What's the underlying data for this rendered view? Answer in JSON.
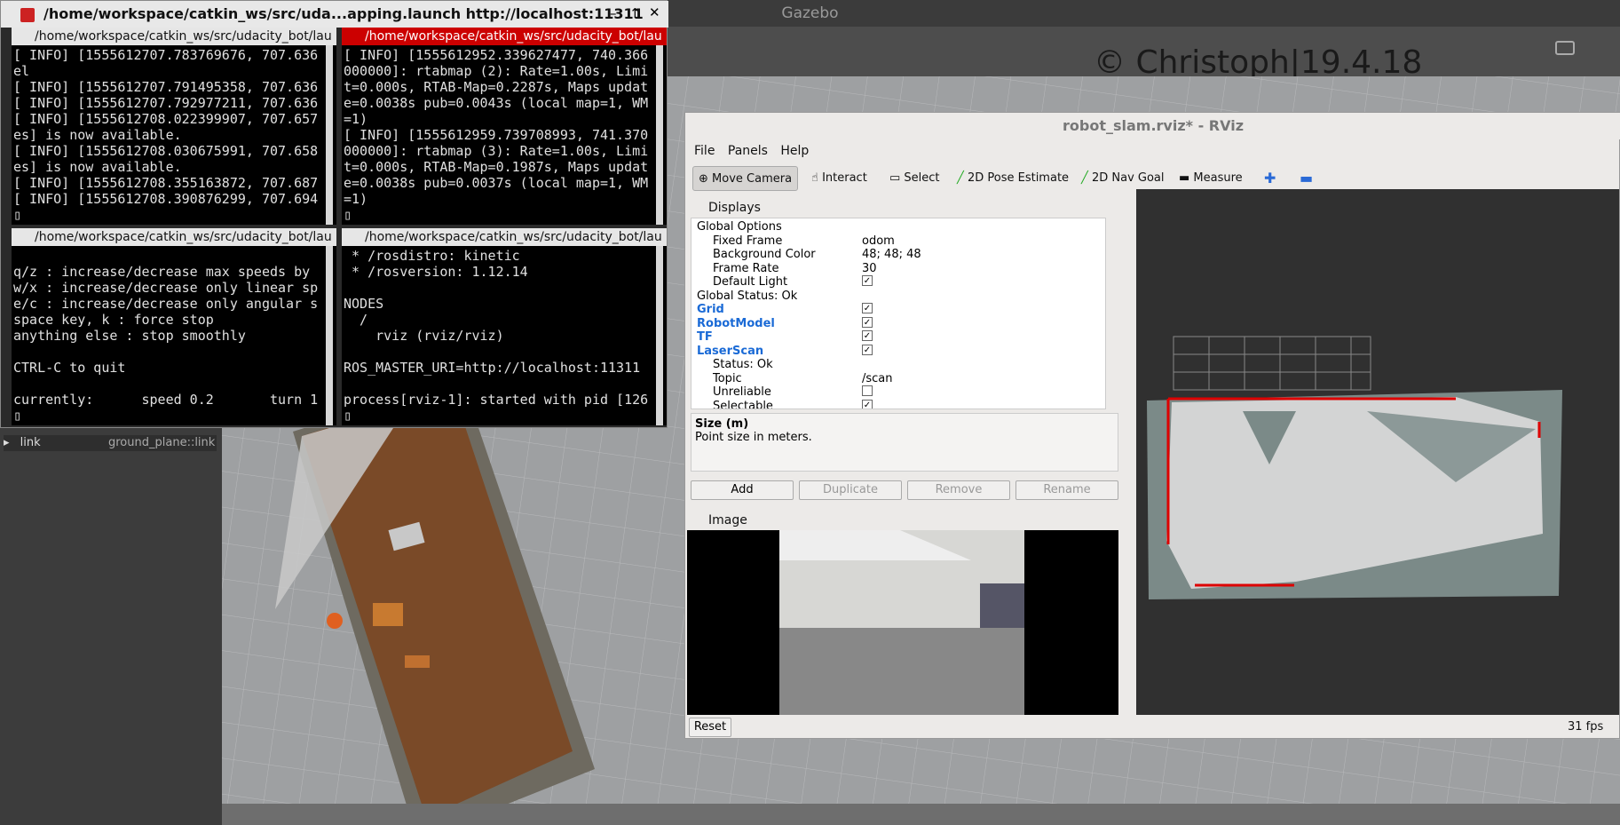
{
  "gazebo": {
    "title": "Gazebo",
    "left_panel_row": "link",
    "left_panel_value": "ground_plane::link",
    "watermark": "© Christoph|19.4.18"
  },
  "terminal": {
    "title": "/home/workspace/catkin_ws/src/uda...apping.launch http://localhost:11311",
    "pane_tl": {
      "header": "/home/workspace/catkin_ws/src/udacity_bot/lau",
      "lines": "[ INFO] [1555612707.783769676, 707.636\nel\n[ INFO] [1555612707.791495358, 707.636\n[ INFO] [1555612707.792977211, 707.636\n[ INFO] [1555612708.022399907, 707.657\nes] is now available.\n[ INFO] [1555612708.030675991, 707.658\nes] is now available.\n[ INFO] [1555612708.355163872, 707.687\n[ INFO] [1555612708.390876299, 707.694\n▯"
    },
    "pane_tr": {
      "header": "/home/workspace/catkin_ws/src/udacity_bot/lau",
      "lines": "[ INFO] [1555612952.339627477, 740.366\n000000]: rtabmap (2): Rate=1.00s, Limi\nt=0.000s, RTAB-Map=0.2287s, Maps updat\ne=0.0038s pub=0.0043s (local map=1, WM\n=1)\n[ INFO] [1555612959.739708993, 741.370\n000000]: rtabmap (3): Rate=1.00s, Limi\nt=0.000s, RTAB-Map=0.1987s, Maps updat\ne=0.0038s pub=0.0037s (local map=1, WM\n=1)\n▯"
    },
    "pane_bl": {
      "header": "/home/workspace/catkin_ws/src/udacity_bot/lau",
      "lines": "\nq/z : increase/decrease max speeds by\nw/x : increase/decrease only linear sp\ne/c : increase/decrease only angular s\nspace key, k : force stop\nanything else : stop smoothly\n\nCTRL-C to quit\n\ncurrently:      speed 0.2       turn 1\n▯"
    },
    "pane_br": {
      "header": "/home/workspace/catkin_ws/src/udacity_bot/lau",
      "lines": " * /rosdistro: kinetic\n * /rosversion: 1.12.14\n\nNODES\n  /\n    rviz (rviz/rviz)\n\nROS_MASTER_URI=http://localhost:11311\n\nprocess[rviz-1]: started with pid [126\n▯"
    }
  },
  "rviz": {
    "title": "robot_slam.rviz* - RViz",
    "menu": [
      "File",
      "Panels",
      "Help"
    ],
    "tools": [
      "Move Camera",
      "Interact",
      "Select",
      "2D Pose Estimate",
      "2D Nav Goal",
      "Measure"
    ],
    "displays_title": "Displays",
    "tree": [
      {
        "label": "Global Options",
        "value": "",
        "style": "normal"
      },
      {
        "label": "Fixed Frame",
        "value": "odom",
        "style": "normal"
      },
      {
        "label": "Background Color",
        "value": "48; 48; 48",
        "style": "normal"
      },
      {
        "label": "Frame Rate",
        "value": "30",
        "style": "normal"
      },
      {
        "label": "Default Light",
        "value": "✓",
        "style": "normal"
      },
      {
        "label": "Global Status: Ok",
        "value": "",
        "style": "normal"
      },
      {
        "label": "Grid",
        "value": "✓",
        "style": "blue"
      },
      {
        "label": "RobotModel",
        "value": "✓",
        "style": "blue"
      },
      {
        "label": "TF",
        "value": "✓",
        "style": "blue"
      },
      {
        "label": "LaserScan",
        "value": "✓",
        "style": "blue"
      },
      {
        "label": "Status: Ok",
        "value": "",
        "style": "normal"
      },
      {
        "label": "Topic",
        "value": "/scan",
        "style": "normal"
      },
      {
        "label": "Unreliable",
        "value": "",
        "style": "normal"
      },
      {
        "label": "Selectable",
        "value": "✓",
        "style": "normal"
      }
    ],
    "desc_title": "Size (m)",
    "desc_text": "Point size in meters.",
    "buttons": [
      "Add",
      "Duplicate",
      "Remove",
      "Rename"
    ],
    "image_title": "Image",
    "reset": "Reset",
    "fps": "31 fps"
  }
}
